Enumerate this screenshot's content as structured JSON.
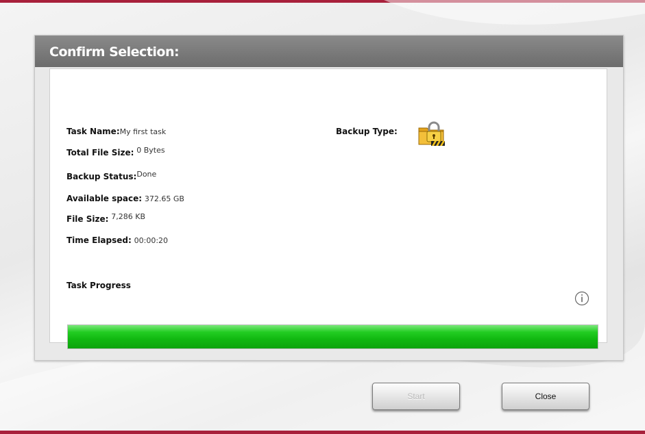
{
  "dialog": {
    "title": "Confirm Selection:"
  },
  "details": {
    "task_name": {
      "label": "Task Name:",
      "value": "My first task"
    },
    "total_file_size": {
      "label": "Total File Size:",
      "value": "0 Bytes"
    },
    "backup_status": {
      "label": "Backup Status:",
      "value": "Done"
    },
    "available_space": {
      "label": "Available space:",
      "value": "372.65 GB"
    },
    "file_size": {
      "label": "File Size:",
      "value": "7,286 KB"
    },
    "time_elapsed": {
      "label": "Time Elapsed:",
      "value": "00:00:20"
    },
    "backup_type": {
      "label": "Backup Type:",
      "icon": "encrypted-backup-lock-icon"
    }
  },
  "progress": {
    "label": "Task Progress",
    "fraction": 1.0,
    "info_icon": "info-icon"
  },
  "buttons": {
    "start_label": "Start",
    "start_enabled": false,
    "close_label": "Close"
  },
  "colors": {
    "accent_bar": "#a8203b",
    "header": "#777777",
    "progress_green": "#16bb16"
  }
}
